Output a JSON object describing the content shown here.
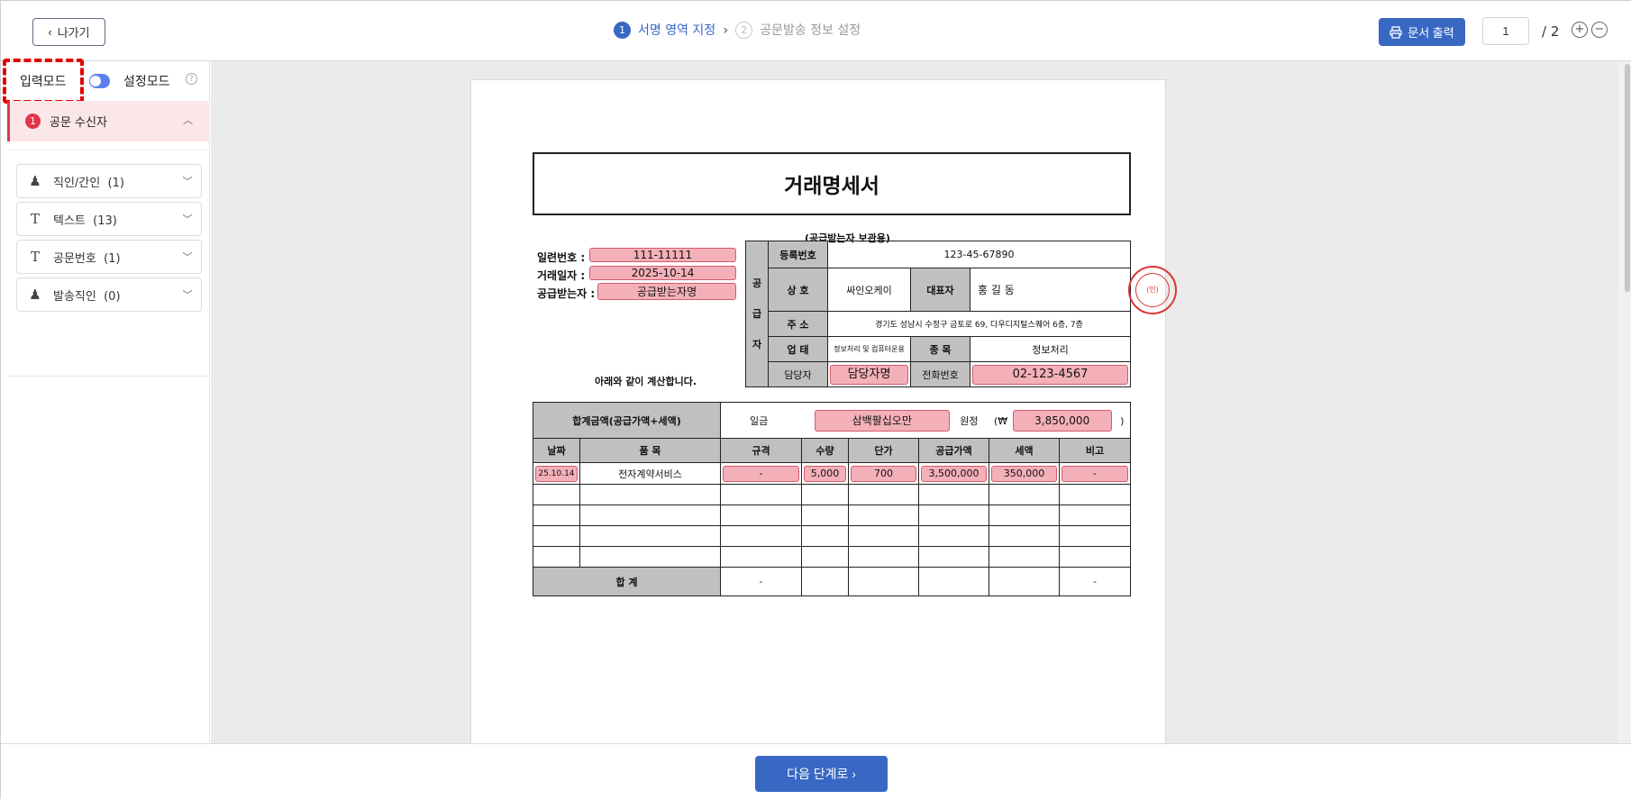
{
  "topbar": {
    "back_label": "나가기",
    "steps": [
      {
        "num": "1",
        "label": "서명 영역 지정"
      },
      {
        "num": "2",
        "label": "공문발송 정보 설정"
      }
    ],
    "print_label": "문서 출력",
    "page_current": "1",
    "page_total": "/ 2"
  },
  "sidebar": {
    "mode_input": "입력모드",
    "mode_setting": "설정모드",
    "help": "?",
    "recipient_num": "1",
    "recipient_label": "공문 수신자",
    "items": [
      {
        "label": "직인/간인",
        "count": "(1)"
      },
      {
        "label": "텍스트",
        "count": "(13)"
      },
      {
        "label": "공문번호",
        "count": "(1)"
      },
      {
        "label": "발송직인",
        "count": "(0)"
      }
    ]
  },
  "document": {
    "title": "거래명세서",
    "copy_label": "(공급받는자 보관용)",
    "serial_label": "일련번호 :",
    "serial_value": "111-11111",
    "date_label": "거래일자 :",
    "date_value": "2025-10-14",
    "receiver_label": "공급받는자 :",
    "receiver_value": "공급받는자명",
    "calc_note": "아래와 같이 계산합니다.",
    "supplier_side": [
      "공",
      "급",
      "자"
    ],
    "reg_label": "등록번호",
    "reg_value": "123-45-67890",
    "company_label": "상 호",
    "company_value": "싸인오케이",
    "ceo_label": "대표자",
    "ceo_value": "홍 길 동",
    "seal_text": "(인)",
    "address_label": "주 소",
    "address_value": "경기도 성남시 수정구 금토로 69, 다우디지털스퀘어 6층, 7층",
    "biz_type_label": "업 태",
    "biz_type_value": "정보처리 및 컴퓨터운용",
    "biz_item_label": "종 목",
    "biz_item_value": "정보처리",
    "manager_label": "담당자",
    "manager_value": "담당자명",
    "phone_label": "전화번호",
    "phone_value": "02-123-4567",
    "total_label": "합계금액(공급가액+세액)",
    "ilgeum": "일금",
    "total_korean": "삼백팔십오만",
    "wonjeong": "원정",
    "won_symbol": "(₩",
    "total_value": "3,850,000",
    "close_paren": ")",
    "columns": [
      "날짜",
      "품 목",
      "규격",
      "수량",
      "단가",
      "공급가액",
      "세액",
      "비고"
    ],
    "row": {
      "date": "25.10.14",
      "item": "전자계약서비스",
      "spec": "-",
      "qty": "5,000",
      "price": "700",
      "supply": "3,500,000",
      "tax": "350,000",
      "note": "-"
    },
    "sum_label": "합 계",
    "sum_spec": "-",
    "sum_note": "-"
  },
  "bottombar": {
    "next_label": "다음 단계로 ›"
  },
  "colors": {
    "primary": "#3868c4",
    "accent_red": "#e0364a",
    "highlight_pink": "#f4b0b8"
  }
}
